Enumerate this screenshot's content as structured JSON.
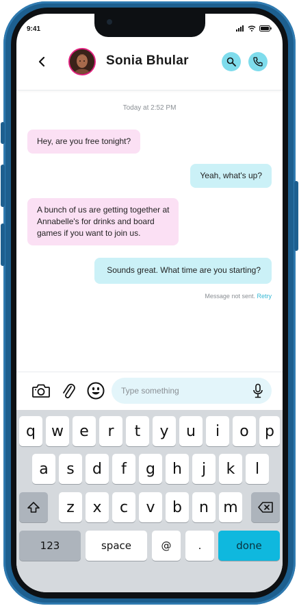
{
  "status_bar": {
    "time": "9:41"
  },
  "header": {
    "back_icon": "chevron-left-icon",
    "contact_name": "Sonia Bhular",
    "search_icon": "search-icon",
    "call_icon": "phone-icon",
    "accent": "#7fdcec",
    "avatar_ring": "#e0207e"
  },
  "chat": {
    "timestamp": "Today at 2:52 PM",
    "messages": [
      {
        "direction": "in",
        "text": "Hey, are you free tonight?"
      },
      {
        "direction": "out",
        "text": "Yeah, what's up?"
      },
      {
        "direction": "in",
        "line1": "A bunch of us are getting together at",
        "line2": "Annabelle's for drinks and board",
        "line3": "games if you want to join us."
      },
      {
        "direction": "out",
        "text": "Sounds great. What time are you starting?"
      }
    ],
    "send_status": "Message not sent.",
    "retry_label": "Retry",
    "incoming_color": "#fbe0f4",
    "outgoing_color": "#cbf1f7"
  },
  "composer": {
    "camera_icon": "camera-icon",
    "attach_icon": "paperclip-icon",
    "emoji_icon": "emoji-icon",
    "placeholder": "Type something",
    "value": "",
    "mic_icon": "microphone-icon"
  },
  "keyboard": {
    "row1": [
      "q",
      "w",
      "e",
      "r",
      "t",
      "y",
      "u",
      "i",
      "o",
      "p"
    ],
    "row2": [
      "a",
      "s",
      "d",
      "f",
      "g",
      "h",
      "j",
      "k",
      "l"
    ],
    "row3": [
      "z",
      "x",
      "c",
      "v",
      "b",
      "n",
      "m"
    ],
    "shift_icon": "shift-icon",
    "backspace_icon": "backspace-icon",
    "numbers_label": "123",
    "space_label": "space",
    "at_label": "@",
    "period_label": ".",
    "done_label": "done",
    "done_color": "#0fb8de"
  }
}
